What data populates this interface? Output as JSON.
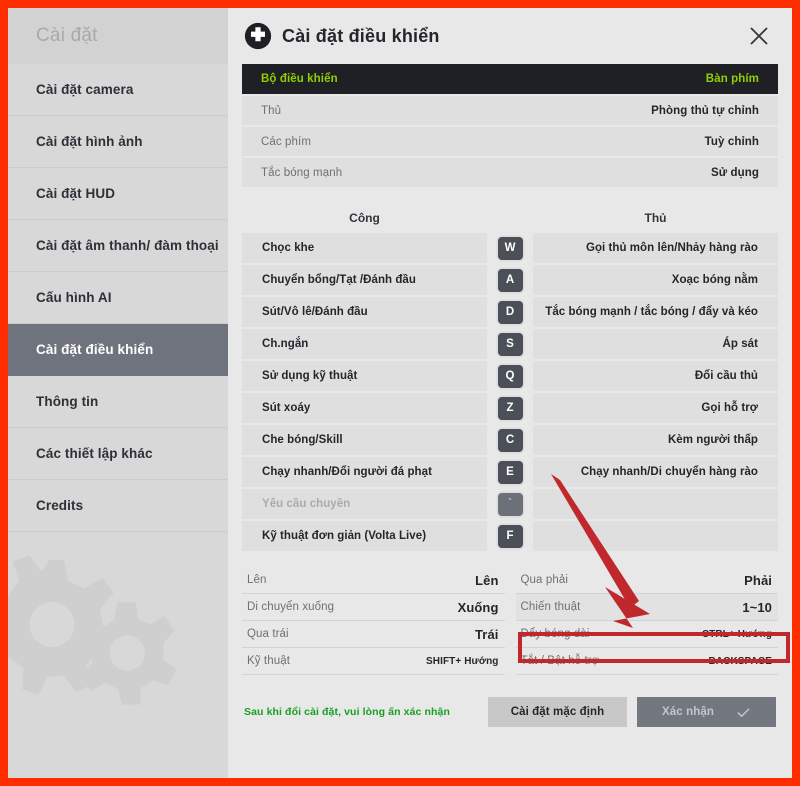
{
  "colors": {
    "frame_red": "#ff2d00",
    "annotation_red": "#c0282d",
    "accent_green": "#8fd000",
    "note_green": "#17a022",
    "active_sidebar": "#6f737d",
    "key_badge": "#4b4f58"
  },
  "sidebar": {
    "header": "Cài đặt",
    "items": [
      {
        "label": "Cài đặt camera",
        "active": false
      },
      {
        "label": "Cài đặt hình ảnh",
        "active": false
      },
      {
        "label": "Cài đặt HUD",
        "active": false
      },
      {
        "label": "Cài đặt âm thanh/ đàm thoại",
        "active": false
      },
      {
        "label": "Cấu hình AI",
        "active": false
      },
      {
        "label": "Cài đặt điều khiển",
        "active": true
      },
      {
        "label": "Thông tin",
        "active": false
      },
      {
        "label": "Các thiết lập khác",
        "active": false
      },
      {
        "label": "Credits",
        "active": false
      }
    ]
  },
  "panel": {
    "title": "Cài đặt điều khiển",
    "icon": "dpad-icon",
    "close_icon": "close-icon"
  },
  "settings_rows": [
    {
      "label": "Bộ điều khiển",
      "value": "Bàn phím",
      "highlight": true
    },
    {
      "label": "Thủ",
      "value": "Phòng thủ tự chỉnh",
      "highlight": false
    },
    {
      "label": "Các phím",
      "value": "Tuỳ chỉnh",
      "highlight": false
    },
    {
      "label": "Tắc bóng mạnh",
      "value": "Sử dụng",
      "highlight": false
    }
  ],
  "keybind_table": {
    "header_left": "Công",
    "header_right": "Thủ",
    "rows": [
      {
        "left": "Chọc khe",
        "key": "W",
        "right": "Gọi thủ môn lên/Nhảy hàng rào",
        "disabled": false
      },
      {
        "left": "Chuyển bổng/Tạt /Đánh đầu",
        "key": "A",
        "right": "Xoạc bóng nằm",
        "disabled": false
      },
      {
        "left": "Sút/Vô lê/Đánh đầu",
        "key": "D",
        "right": "Tắc bóng mạnh / tắc bóng / đẩy và kéo",
        "disabled": false
      },
      {
        "left": "Ch.ngắn",
        "key": "S",
        "right": "Áp sát",
        "disabled": false
      },
      {
        "left": "Sử dụng kỹ thuật",
        "key": "Q",
        "right": "Đổi cầu thủ",
        "disabled": false
      },
      {
        "left": "Sút xoáy",
        "key": "Z",
        "right": "Gọi hỗ trợ",
        "disabled": false
      },
      {
        "left": "Che bóng/Skill",
        "key": "C",
        "right": "Kèm người thấp",
        "disabled": false
      },
      {
        "left": "Chạy nhanh/Đổi người đá phạt",
        "key": "E",
        "right": "Chạy nhanh/Di chuyển hàng rào",
        "disabled": false
      },
      {
        "left": "Yêu cầu chuyền",
        "key": "`",
        "right": "",
        "disabled": true
      },
      {
        "left": "Kỹ thuật đơn giản (Volta Live)",
        "key": "F",
        "right": "",
        "disabled": false
      }
    ]
  },
  "movement": {
    "left_column": [
      {
        "label": "Lên",
        "value": "Lên",
        "small": false,
        "highlight": false
      },
      {
        "label": "Di chuyển xuống",
        "value": "Xuống",
        "small": false,
        "highlight": false
      },
      {
        "label": "Qua trái",
        "value": "Trái",
        "small": false,
        "highlight": false
      },
      {
        "label": "Kỹ thuật",
        "value": "SHIFT+ Hướng",
        "small": true,
        "highlight": false
      }
    ],
    "right_column": [
      {
        "label": "Qua phải",
        "value": "Phải",
        "small": false,
        "highlight": false
      },
      {
        "label": "Chiến thuật",
        "value": "1~10",
        "small": false,
        "highlight": true
      },
      {
        "label": "Đẩy bóng dài",
        "value": "CTRL+ Hướng",
        "small": true,
        "highlight": false
      },
      {
        "label": "Tắt / Bật hỗ trợ",
        "value": "BACKSPACE",
        "small": true,
        "highlight": false
      }
    ]
  },
  "footer": {
    "note": "Sau khi đổi cài đặt, vui lòng ấn xác nhận",
    "default_button": "Cài đặt mặc định",
    "confirm_button": "Xác nhận",
    "confirm_icon": "check-icon"
  },
  "annotations": {
    "arrow": "red-arrow-pointing-to-chien-thuat",
    "highlight_box": "red-rectangle-around-chien-thuat-row"
  }
}
